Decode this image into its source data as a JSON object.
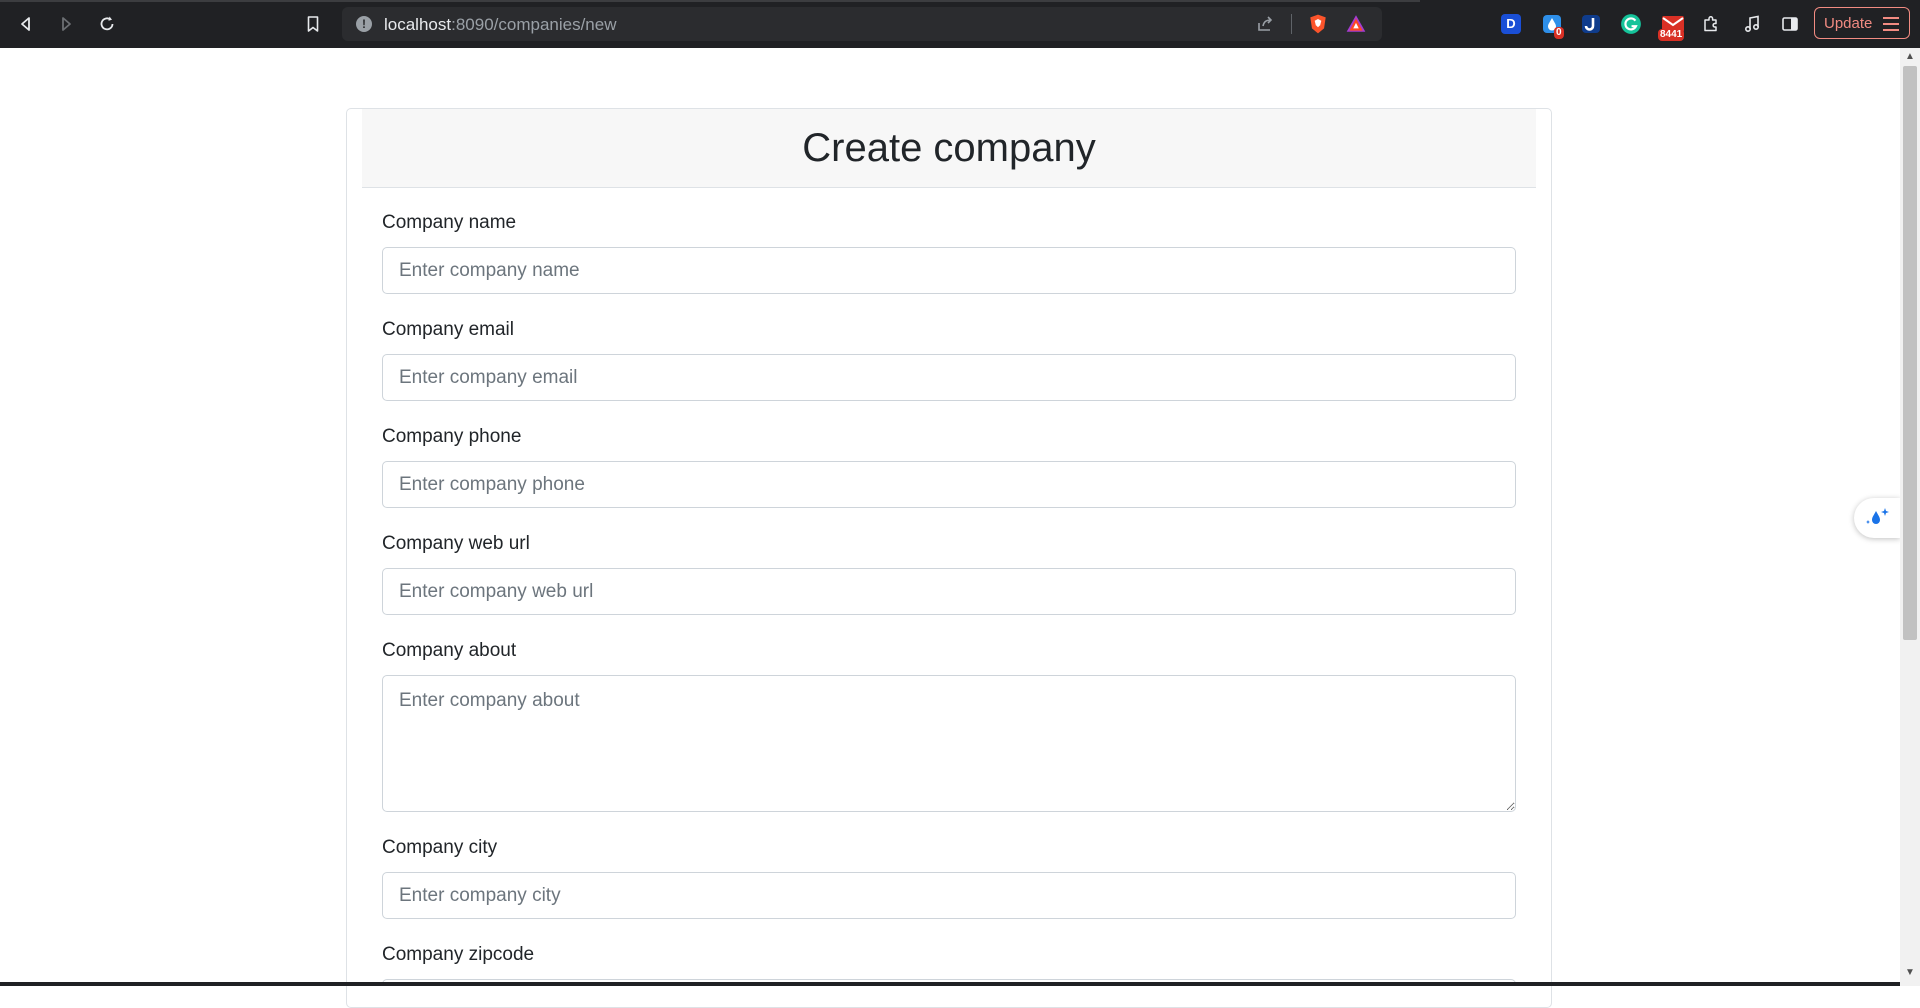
{
  "browser": {
    "url_host": "localhost",
    "url_path": ":8090/companies/new",
    "extensions": {
      "dashlane_letter": "D",
      "raindrop_badge": "0",
      "mail_badge": "8441"
    },
    "update_label": "Update"
  },
  "page": {
    "title": "Create company",
    "fields": [
      {
        "label": "Company name",
        "placeholder": "Enter company name",
        "value": ""
      },
      {
        "label": "Company email",
        "placeholder": "Enter company email",
        "value": ""
      },
      {
        "label": "Company phone",
        "placeholder": "Enter company phone",
        "value": ""
      },
      {
        "label": "Company web url",
        "placeholder": "Enter company web url",
        "value": ""
      },
      {
        "label": "Company about",
        "placeholder": "Enter company about",
        "value": ""
      },
      {
        "label": "Company city",
        "placeholder": "Enter company city",
        "value": ""
      },
      {
        "label": "Company zipcode"
      }
    ]
  },
  "colors": {
    "chrome_bg": "#202124",
    "header_bg": "#f7f7f7",
    "update_accent": "#f28b82"
  }
}
